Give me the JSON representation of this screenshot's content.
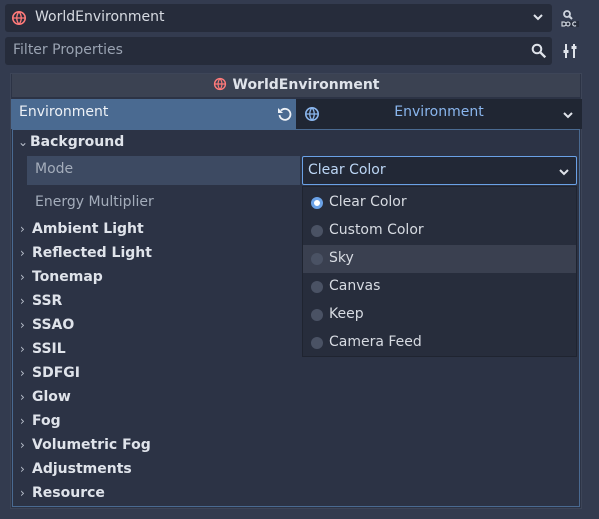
{
  "node_selector": {
    "value": "WorldEnvironment"
  },
  "filter": {
    "placeholder": "Filter Properties"
  },
  "inspector": {
    "object_title": "WorldEnvironment",
    "property_label": "Environment",
    "resource_value": "Environment"
  },
  "sections": {
    "background": "Background",
    "ambient_light": "Ambient Light",
    "reflected_light": "Reflected Light",
    "tonemap": "Tonemap",
    "ssr": "SSR",
    "ssao": "SSAO",
    "ssil": "SSIL",
    "sdfgi": "SDFGI",
    "glow": "Glow",
    "fog": "Fog",
    "volumetric_fog": "Volumetric Fog",
    "adjustments": "Adjustments",
    "resource": "Resource"
  },
  "background": {
    "mode_label": "Mode",
    "mode_value": "Clear Color",
    "energy_label": "Energy Multiplier"
  },
  "mode_options": [
    {
      "label": "Clear Color",
      "selected": true
    },
    {
      "label": "Custom Color",
      "selected": false
    },
    {
      "label": "Sky",
      "selected": false
    },
    {
      "label": "Canvas",
      "selected": false
    },
    {
      "label": "Keep",
      "selected": false
    },
    {
      "label": "Camera Feed",
      "selected": false
    }
  ],
  "colors": {
    "accent": "#6aa1e6",
    "panel_bg": "#333b4f",
    "highlight_row": "#4a6a91"
  },
  "icons": {
    "node": "globe-icon",
    "doc": "doc-icon",
    "search": "search-icon",
    "filter_options": "tools-icon",
    "reset": "revert-icon",
    "dropdown": "chevron-down-icon"
  }
}
